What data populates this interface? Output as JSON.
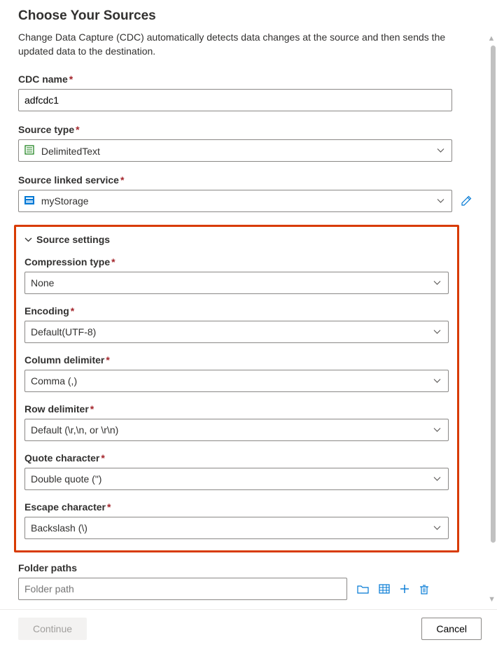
{
  "header": {
    "title": "Choose Your Sources",
    "subtitle": "Change Data Capture (CDC) automatically detects data changes at the source and then sends the updated data to the destination."
  },
  "fields": {
    "cdc_name": {
      "label": "CDC name",
      "value": "adfcdc1"
    },
    "source_type": {
      "label": "Source type",
      "value": "DelimitedText"
    },
    "source_linked_service": {
      "label": "Source linked service",
      "value": "myStorage"
    }
  },
  "source_settings": {
    "section_title": "Source settings",
    "compression_type": {
      "label": "Compression type",
      "value": "None"
    },
    "encoding": {
      "label": "Encoding",
      "value": "Default(UTF-8)"
    },
    "column_delimiter": {
      "label": "Column delimiter",
      "value": "Comma (,)"
    },
    "row_delimiter": {
      "label": "Row delimiter",
      "value": "Default (\\r,\\n, or \\r\\n)"
    },
    "quote_character": {
      "label": "Quote character",
      "value": "Double quote (\")"
    },
    "escape_character": {
      "label": "Escape character",
      "value": "Backslash (\\)"
    }
  },
  "folder_paths": {
    "label": "Folder paths",
    "placeholder": "Folder path"
  },
  "footer": {
    "continue": "Continue",
    "cancel": "Cancel"
  }
}
